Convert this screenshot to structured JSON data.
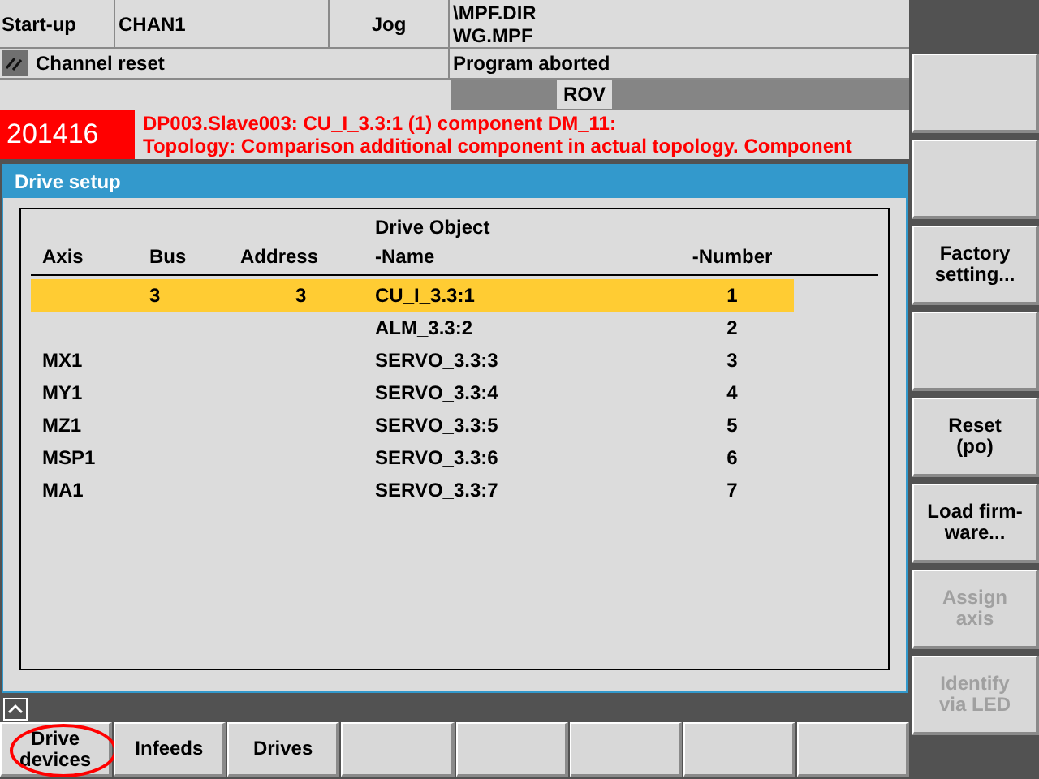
{
  "header": {
    "mode": "Start-up",
    "channel": "CHAN1",
    "op_mode": "Jog",
    "program_path": [
      "\\MPF.DIR",
      "WG.MPF"
    ],
    "channel_status": "Channel reset",
    "program_status": "Program aborted",
    "override": "ROV"
  },
  "alarm": {
    "number": "201416",
    "lines": [
      "DP003.Slave003: CU_I_3.3:1 (1) component DM_11:",
      "Topology: Comparison additional component in actual topology. Component"
    ]
  },
  "panel": {
    "title": "Drive setup",
    "group_heading": "Drive Object",
    "columns": [
      "Axis",
      "Bus",
      "Address",
      "-Name",
      "-Number"
    ],
    "rows": [
      {
        "axis": "",
        "bus": "3",
        "address": "3",
        "name": "CU_I_3.3:1",
        "number": "1",
        "selected": true
      },
      {
        "axis": "",
        "bus": "",
        "address": "",
        "name": "ALM_3.3:2",
        "number": "2",
        "selected": false
      },
      {
        "axis": "MX1",
        "bus": "",
        "address": "",
        "name": "SERVO_3.3:3",
        "number": "3",
        "selected": false
      },
      {
        "axis": "MY1",
        "bus": "",
        "address": "",
        "name": "SERVO_3.3:4",
        "number": "4",
        "selected": false
      },
      {
        "axis": "MZ1",
        "bus": "",
        "address": "",
        "name": "SERVO_3.3:5",
        "number": "5",
        "selected": false
      },
      {
        "axis": "MSP1",
        "bus": "",
        "address": "",
        "name": "SERVO_3.3:6",
        "number": "6",
        "selected": false
      },
      {
        "axis": "MA1",
        "bus": "",
        "address": "",
        "name": "SERVO_3.3:7",
        "number": "7",
        "selected": false
      }
    ]
  },
  "vertical_softkeys": [
    {
      "kind": "empty"
    },
    {
      "kind": "empty"
    },
    {
      "kind": "label",
      "lines": [
        "Factory",
        "setting..."
      ],
      "disabled": false
    },
    {
      "kind": "empty"
    },
    {
      "kind": "label",
      "lines": [
        "Reset",
        "(po)"
      ],
      "disabled": false
    },
    {
      "kind": "label",
      "lines": [
        "Load firm-",
        "ware..."
      ],
      "disabled": false
    },
    {
      "kind": "label",
      "lines": [
        "Assign",
        "axis"
      ],
      "disabled": true
    },
    {
      "kind": "label",
      "lines": [
        "Identify",
        "via LED"
      ],
      "disabled": true
    }
  ],
  "horizontal_softkeys": [
    {
      "kind": "label",
      "lines": [
        "Drive",
        "devices"
      ],
      "circled": true
    },
    {
      "kind": "label",
      "lines": [
        "Infeeds"
      ],
      "circled": false
    },
    {
      "kind": "label",
      "lines": [
        "Drives"
      ],
      "circled": false
    },
    {
      "kind": "empty"
    },
    {
      "kind": "empty"
    },
    {
      "kind": "empty"
    },
    {
      "kind": "empty"
    },
    {
      "kind": "empty"
    }
  ]
}
